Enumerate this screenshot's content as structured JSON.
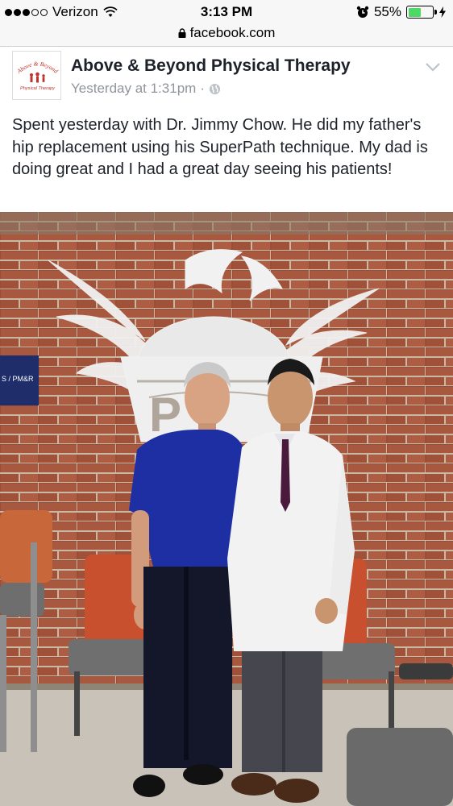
{
  "status_bar": {
    "carrier": "Verizon",
    "time": "3:13 PM",
    "battery": "55%",
    "battery_level": 0.55,
    "signal_bars_filled": 3,
    "signal_bars_total": 5
  },
  "browser": {
    "url": "facebook.com"
  },
  "post": {
    "page_name": "Above & Beyond Physical Therapy",
    "timestamp": "Yesterday at 1:31pm",
    "separator": "·",
    "audience_icon": "globe-icon",
    "text": "Spent yesterday with Dr. Jimmy Chow. He did my father's hip replacement using his SuperPath technique. My dad is doing great and I had a great day seeing his patients!",
    "avatar": {
      "line1": "Above & Beyond",
      "line2": "Physical Therapy"
    }
  },
  "photo": {
    "wall_sign_label": "S / PM&R"
  },
  "colors": {
    "text_primary": "#1d2129",
    "text_secondary": "#90949c",
    "battery_green": "#4cd964",
    "brick": "#a5523a",
    "polo_blue": "#1d2fa3",
    "chair_red": "#c8502f"
  }
}
